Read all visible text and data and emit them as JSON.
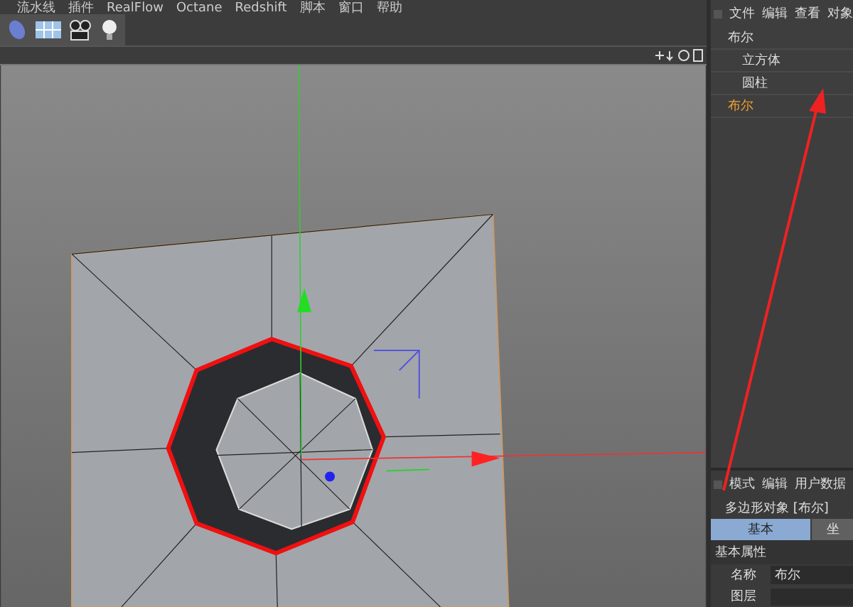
{
  "menu_bar": [
    "流水线",
    "插件",
    "RealFlow",
    "Octane",
    "Redshift",
    "脚本",
    "窗口",
    "帮助"
  ],
  "object_manager": {
    "menu": [
      "文件",
      "编辑",
      "查看",
      "对象"
    ],
    "objects": [
      {
        "name": "布尔",
        "selected": false,
        "children": [
          {
            "name": "立方体",
            "selected": false
          },
          {
            "name": "圆柱",
            "selected": false
          }
        ]
      },
      {
        "name": "布尔",
        "selected": true
      }
    ]
  },
  "attributes": {
    "menu": [
      "模式",
      "编辑",
      "用户数据"
    ],
    "object_title": "多边形对象 [布尔]",
    "tabs": [
      {
        "label": "基本",
        "selected": true
      },
      {
        "label": "坐",
        "selected": false
      }
    ],
    "section": "基本属性",
    "fields": [
      {
        "label": "名称",
        "value": "布尔"
      },
      {
        "label": "图层"
      }
    ]
  }
}
